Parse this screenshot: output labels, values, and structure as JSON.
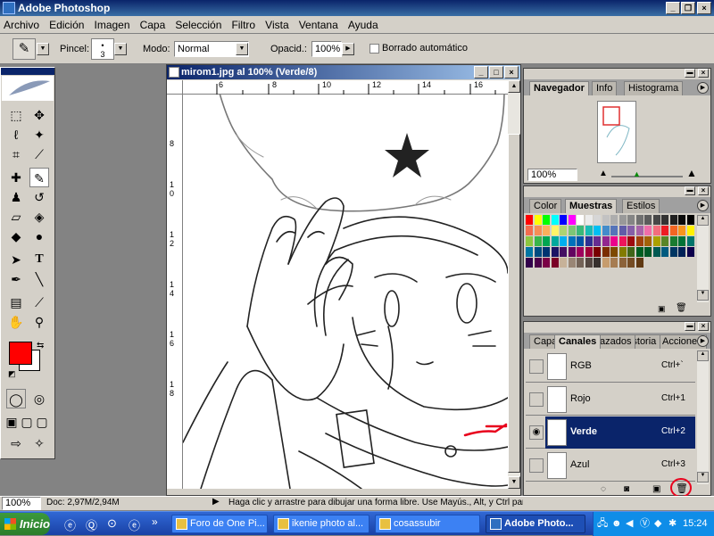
{
  "app": {
    "title": "Adobe Photoshop"
  },
  "menu": [
    "Archivo",
    "Edición",
    "Imagen",
    "Capa",
    "Selección",
    "Filtro",
    "Vista",
    "Ventana",
    "Ayuda"
  ],
  "options": {
    "brush_label": "Pincel:",
    "brush_size": "3",
    "mode_label": "Modo:",
    "mode_value": "Normal",
    "opacity_label": "Opacid.:",
    "opacity_value": "100%",
    "auto_erase_label": "Borrado automático"
  },
  "document": {
    "title": "mirom1.jpg al 100% (Verde/8)",
    "ruler_top": [
      "6",
      "8",
      "10",
      "12",
      "14",
      "16"
    ],
    "ruler_left": [
      "8",
      "1",
      "0",
      "1",
      "2",
      "1",
      "4",
      "1",
      "6",
      "1",
      "8"
    ]
  },
  "navigator": {
    "tabs": [
      "Navegador",
      "Info",
      "Histograma"
    ],
    "zoom": "100%"
  },
  "swatches": {
    "tabs": [
      "Color",
      "Muestras",
      "Estilos"
    ],
    "colors": [
      "#ff0000",
      "#ffff00",
      "#00ff00",
      "#00ffff",
      "#0000ff",
      "#ff00ff",
      "#ffffff",
      "#ebebeb",
      "#d6d6d6",
      "#c2c2c2",
      "#adadad",
      "#999999",
      "#858585",
      "#707070",
      "#5c5c5c",
      "#474747",
      "#333333",
      "#1f1f1f",
      "#0a0a0a",
      "#000000",
      "#f26c4f",
      "#f68e55",
      "#fbaf5c",
      "#fff467",
      "#acd372",
      "#7cc576",
      "#3bb878",
      "#1abbb4",
      "#00bff3",
      "#438ccb",
      "#5574b9",
      "#605ca8",
      "#855fa8",
      "#a763a8",
      "#f06ea9",
      "#f26d7d",
      "#ed1c24",
      "#f26522",
      "#f7941d",
      "#fff200",
      "#8dc63f",
      "#39b54a",
      "#00a651",
      "#00a99d",
      "#00aeef",
      "#0072bc",
      "#0054a6",
      "#2e3192",
      "#662d91",
      "#92278f",
      "#ec008c",
      "#ed145b",
      "#9e0b0f",
      "#a0410d",
      "#a36209",
      "#aba000",
      "#598527",
      "#1a7b30",
      "#007236",
      "#00746b",
      "#0076a3",
      "#004b80",
      "#003471",
      "#1b1464",
      "#440e62",
      "#630460",
      "#9e005d",
      "#9e0039",
      "#790000",
      "#7b2e00",
      "#7d4900",
      "#827b00",
      "#406618",
      "#005e20",
      "#005826",
      "#005952",
      "#005b7f",
      "#003663",
      "#002157",
      "#0d004c",
      "#32004b",
      "#4b0049",
      "#7b0046",
      "#7a0026",
      "#c7b299",
      "#998675",
      "#736357",
      "#534741",
      "#37302d",
      "#c69c6d",
      "#a67c52",
      "#8c6239",
      "#754c24",
      "#603913"
    ]
  },
  "channels": {
    "tabs": [
      "Capas",
      "Canales",
      "Trazados",
      "Historia",
      "Acciones"
    ],
    "items": [
      {
        "name": "RGB",
        "shortcut": "Ctrl+`",
        "selected": false,
        "visible": false
      },
      {
        "name": "Rojo",
        "shortcut": "Ctrl+1",
        "selected": false,
        "visible": false
      },
      {
        "name": "Verde",
        "shortcut": "Ctrl+2",
        "selected": true,
        "visible": true
      },
      {
        "name": "Azul",
        "shortcut": "Ctrl+3",
        "selected": false,
        "visible": false
      }
    ]
  },
  "status": {
    "zoom": "100%",
    "doc": "Doc: 2,97M/2,94M",
    "hint": "Haga clic y arrastre para dibujar una forma libre. Use Mayús., Alt, y Ctrl para opciones adicionales."
  },
  "taskbar": {
    "start": "Inicio",
    "tasks": [
      "Foro de One Pi...",
      "ikenie photo al...",
      "cosassubir",
      "Adobe Photo..."
    ],
    "clock": "15:24"
  },
  "colors": {
    "foreground": "#ff0000",
    "background": "#ffffff",
    "annotation": "#e8001c"
  }
}
